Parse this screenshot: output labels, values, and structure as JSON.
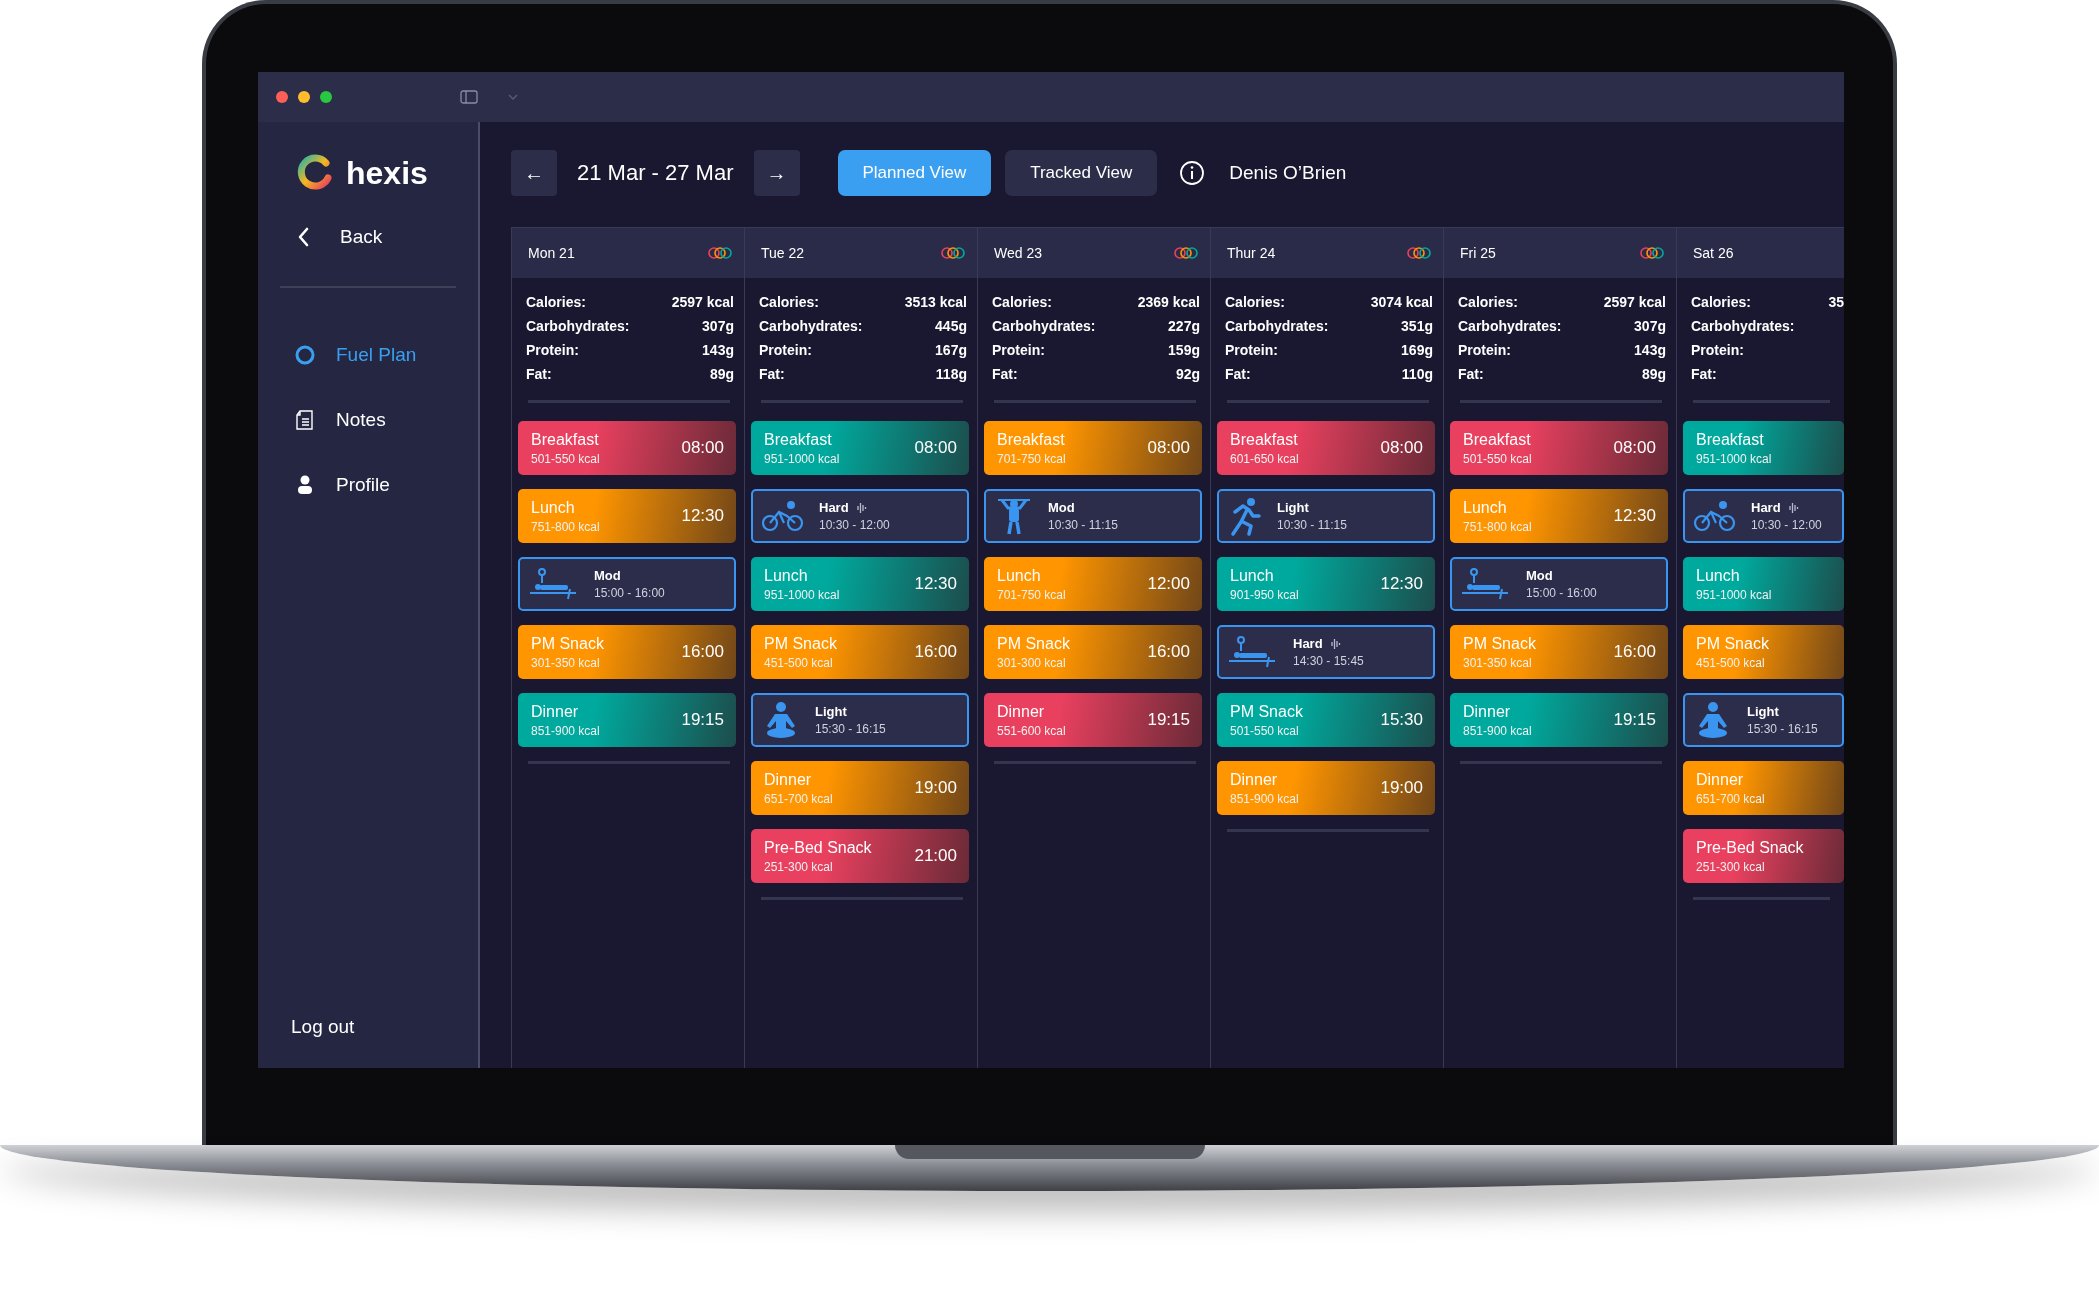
{
  "sidebar": {
    "logo": "hexis",
    "back": "Back",
    "items": [
      {
        "label": "Fuel Plan",
        "kind": "circle",
        "selected": true
      },
      {
        "label": "Notes",
        "kind": "notes",
        "selected": false
      },
      {
        "label": "Profile",
        "kind": "person",
        "selected": false
      }
    ],
    "logout": "Log out"
  },
  "header": {
    "prev": "←",
    "range": "21 Mar - 27 Mar",
    "next": "→",
    "views": [
      {
        "label": "Planned View",
        "selected": true
      },
      {
        "label": "Tracked View",
        "selected": false
      }
    ],
    "user": "Denis O’Brien"
  },
  "days": [
    {
      "date": "Mon 21",
      "rings": true,
      "nutrients": [
        {
          "label": "Calories:",
          "value": "2597 kcal"
        },
        {
          "label": "Carbohydrates:",
          "value": "307g"
        },
        {
          "label": "Protein:",
          "value": "143g"
        },
        {
          "label": "Fat:",
          "value": "89g"
        }
      ],
      "entries": [
        {
          "kind": "meal",
          "title": "Breakfast",
          "sub": "501-550 kcal",
          "time": "08:00",
          "color": "#e8405e"
        },
        {
          "kind": "meal",
          "title": "Lunch",
          "sub": "751-800 kcal",
          "time": "12:30",
          "color": "#ff9500"
        },
        {
          "kind": "bench",
          "title": "Mod",
          "sub": "15:00 - 16:00",
          "signal": false
        },
        {
          "kind": "meal",
          "title": "PM Snack",
          "sub": "301-350 kcal",
          "time": "16:00",
          "color": "#ff9500"
        },
        {
          "kind": "meal",
          "title": "Dinner",
          "sub": "851-900 kcal",
          "time": "19:15",
          "color": "#00a99d"
        }
      ]
    },
    {
      "date": "Tue 22",
      "rings": true,
      "nutrients": [
        {
          "label": "Calories:",
          "value": "3513 kcal"
        },
        {
          "label": "Carbohydrates:",
          "value": "445g"
        },
        {
          "label": "Protein:",
          "value": "167g"
        },
        {
          "label": "Fat:",
          "value": "118g"
        }
      ],
      "entries": [
        {
          "kind": "meal",
          "title": "Breakfast",
          "sub": "951-1000 kcal",
          "time": "08:00",
          "color": "#00a99d"
        },
        {
          "kind": "bike",
          "title": "Hard",
          "sub": "10:30 - 12:00",
          "signal": true
        },
        {
          "kind": "meal",
          "title": "Lunch",
          "sub": "951-1000 kcal",
          "time": "12:30",
          "color": "#00a99d"
        },
        {
          "kind": "meal",
          "title": "PM Snack",
          "sub": "451-500 kcal",
          "time": "16:00",
          "color": "#ff9500"
        },
        {
          "kind": "yoga",
          "title": "Light",
          "sub": "15:30 - 16:15",
          "signal": false
        },
        {
          "kind": "meal",
          "title": "Dinner",
          "sub": "651-700 kcal",
          "time": "19:00",
          "color": "#ff9500"
        },
        {
          "kind": "meal",
          "title": "Pre-Bed Snack",
          "sub": "251-300 kcal",
          "time": "21:00",
          "color": "#e8405e"
        }
      ]
    },
    {
      "date": "Wed 23",
      "rings": true,
      "nutrients": [
        {
          "label": "Calories:",
          "value": "2369 kcal"
        },
        {
          "label": "Carbohydrates:",
          "value": "227g"
        },
        {
          "label": "Protein:",
          "value": "159g"
        },
        {
          "label": "Fat:",
          "value": "92g"
        }
      ],
      "entries": [
        {
          "kind": "meal",
          "title": "Breakfast",
          "sub": "701-750 kcal",
          "time": "08:00",
          "color": "#ff9500"
        },
        {
          "kind": "pullup",
          "title": "Mod",
          "sub": "10:30 - 11:15",
          "signal": false
        },
        {
          "kind": "meal",
          "title": "Lunch",
          "sub": "701-750 kcal",
          "time": "12:00",
          "color": "#ff9500"
        },
        {
          "kind": "meal",
          "title": "PM Snack",
          "sub": "301-300 kcal",
          "time": "16:00",
          "color": "#ff9500"
        },
        {
          "kind": "meal",
          "title": "Dinner",
          "sub": "551-600 kcal",
          "time": "19:15",
          "color": "#e8405e"
        }
      ]
    },
    {
      "date": "Thur 24",
      "rings": true,
      "nutrients": [
        {
          "label": "Calories:",
          "value": "3074 kcal"
        },
        {
          "label": "Carbohydrates:",
          "value": "351g"
        },
        {
          "label": "Protein:",
          "value": "169g"
        },
        {
          "label": "Fat:",
          "value": "110g"
        }
      ],
      "entries": [
        {
          "kind": "meal",
          "title": "Breakfast",
          "sub": "601-650 kcal",
          "time": "08:00",
          "color": "#e8405e"
        },
        {
          "kind": "run",
          "title": "Light",
          "sub": "10:30 - 11:15",
          "signal": false
        },
        {
          "kind": "meal",
          "title": "Lunch",
          "sub": "901-950 kcal",
          "time": "12:30",
          "color": "#00a99d"
        },
        {
          "kind": "bench",
          "title": "Hard",
          "sub": "14:30 - 15:45",
          "signal": true
        },
        {
          "kind": "meal",
          "title": "PM Snack",
          "sub": "501-550 kcal",
          "time": "15:30",
          "color": "#00a99d"
        },
        {
          "kind": "meal",
          "title": "Dinner",
          "sub": "851-900 kcal",
          "time": "19:00",
          "color": "#ff9500"
        }
      ]
    },
    {
      "date": "Fri 25",
      "rings": true,
      "nutrients": [
        {
          "label": "Calories:",
          "value": "2597 kcal"
        },
        {
          "label": "Carbohydrates:",
          "value": "307g"
        },
        {
          "label": "Protein:",
          "value": "143g"
        },
        {
          "label": "Fat:",
          "value": "89g"
        }
      ],
      "entries": [
        {
          "kind": "meal",
          "title": "Breakfast",
          "sub": "501-550 kcal",
          "time": "08:00",
          "color": "#e8405e"
        },
        {
          "kind": "meal",
          "title": "Lunch",
          "sub": "751-800 kcal",
          "time": "12:30",
          "color": "#ff9500"
        },
        {
          "kind": "bench",
          "title": "Mod",
          "sub": "15:00 - 16:00",
          "signal": false
        },
        {
          "kind": "meal",
          "title": "PM Snack",
          "sub": "301-350 kcal",
          "time": "16:00",
          "color": "#ff9500"
        },
        {
          "kind": "meal",
          "title": "Dinner",
          "sub": "851-900 kcal",
          "time": "19:15",
          "color": "#00a99d"
        }
      ]
    },
    {
      "date": "Sat 26",
      "rings": false,
      "nutrients": [
        {
          "label": "Calories:",
          "value": "35"
        },
        {
          "label": "Carbohydrates:"
        },
        {
          "label": "Protein:"
        },
        {
          "label": "Fat:"
        }
      ],
      "entries": [
        {
          "kind": "meal",
          "title": "Breakfast",
          "sub": "951-1000 kcal",
          "color": "#00a99d"
        },
        {
          "kind": "bike",
          "title": "Hard",
          "sub": "10:30 - 12:00",
          "signal": true
        },
        {
          "kind": "meal",
          "title": "Lunch",
          "sub": "951-1000 kcal",
          "color": "#00a99d"
        },
        {
          "kind": "meal",
          "title": "PM Snack",
          "sub": "451-500 kcal",
          "color": "#ff9500"
        },
        {
          "kind": "yoga",
          "title": "Light",
          "sub": "15:30 - 16:15",
          "signal": false
        },
        {
          "kind": "meal",
          "title": "Dinner",
          "sub": "651-700 kcal",
          "color": "#ff9500"
        },
        {
          "kind": "meal",
          "title": "Pre-Bed Snack",
          "sub": "251-300 kcal",
          "color": "#e8405e"
        }
      ]
    }
  ]
}
